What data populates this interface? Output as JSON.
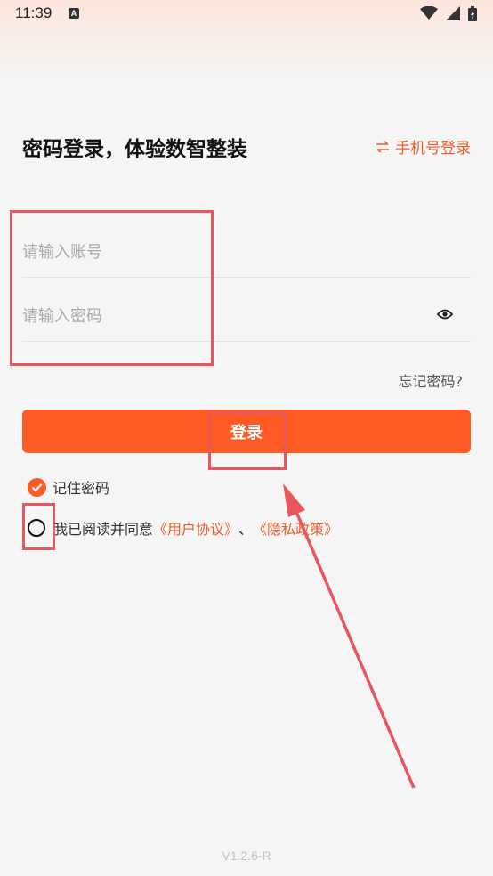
{
  "status_bar": {
    "time": "11:39",
    "notification_letter": "A"
  },
  "header": {
    "title": "密码登录，体验数智整装",
    "switch_link": "手机号登录"
  },
  "form": {
    "account_placeholder": "请输入账号",
    "password_placeholder": "请输入密码",
    "forgot_password": "忘记密码?",
    "login_button": "登录",
    "remember_password": "记住密码",
    "remember_checked": true,
    "agreement_checked": false,
    "agreement_prefix": "我已阅读并同意",
    "user_agreement": "《用户协议》",
    "separator": "、",
    "privacy_policy": "《隐私政策》"
  },
  "footer": {
    "version": "V1.2.6-R"
  },
  "colors": {
    "accent": "#ff5a24",
    "link": "#e8602b",
    "annotation": "#e8575c"
  },
  "icons": [
    "wifi-icon",
    "signal-icon",
    "battery-icon",
    "swap-arrows-icon",
    "eye-icon",
    "checkmark-circle-icon",
    "radio-unchecked-icon"
  ]
}
